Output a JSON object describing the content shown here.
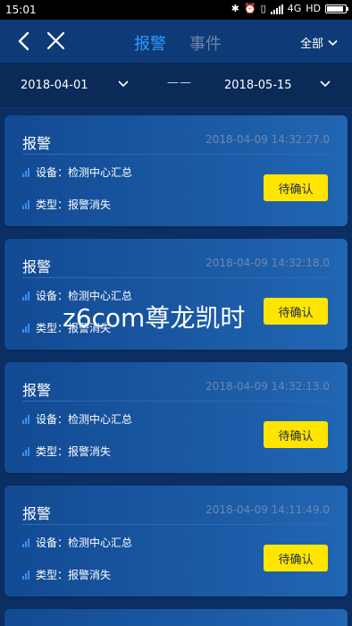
{
  "status_bar": {
    "time": "15:01",
    "network": "4G",
    "hd_label": "HD"
  },
  "nav": {
    "tabs": [
      {
        "label": "报警",
        "active": true
      },
      {
        "label": "事件",
        "active": false
      }
    ],
    "filter_label": "全部",
    "active_color": "#2f9bff",
    "inactive_color": "#6d84a8"
  },
  "date_range": {
    "start": "2018-04-01",
    "separator": "——",
    "end": "2018-05-15"
  },
  "alarms": [
    {
      "title": "报警",
      "timestamp": "2018-04-09 14:32:27.0",
      "device": "设备：检测中心汇总",
      "type": "类型：报警消失",
      "action": "待确认"
    },
    {
      "title": "报警",
      "timestamp": "2018-04-09 14:32:18.0",
      "device": "设备：检测中心汇总",
      "type": "类型：报警消失",
      "action": "待确认"
    },
    {
      "title": "报警",
      "timestamp": "2018-04-09 14:32:13.0",
      "device": "设备：检测中心汇总",
      "type": "类型：报警消失",
      "action": "待确认"
    },
    {
      "title": "报警",
      "timestamp": "2018-04-09 14:11:49.0",
      "device": "设备：检测中心汇总",
      "type": "类型：报警消失",
      "action": "待确认"
    }
  ],
  "watermark": "z6com尊龙凯时",
  "accent_button_color": "#ffe500"
}
